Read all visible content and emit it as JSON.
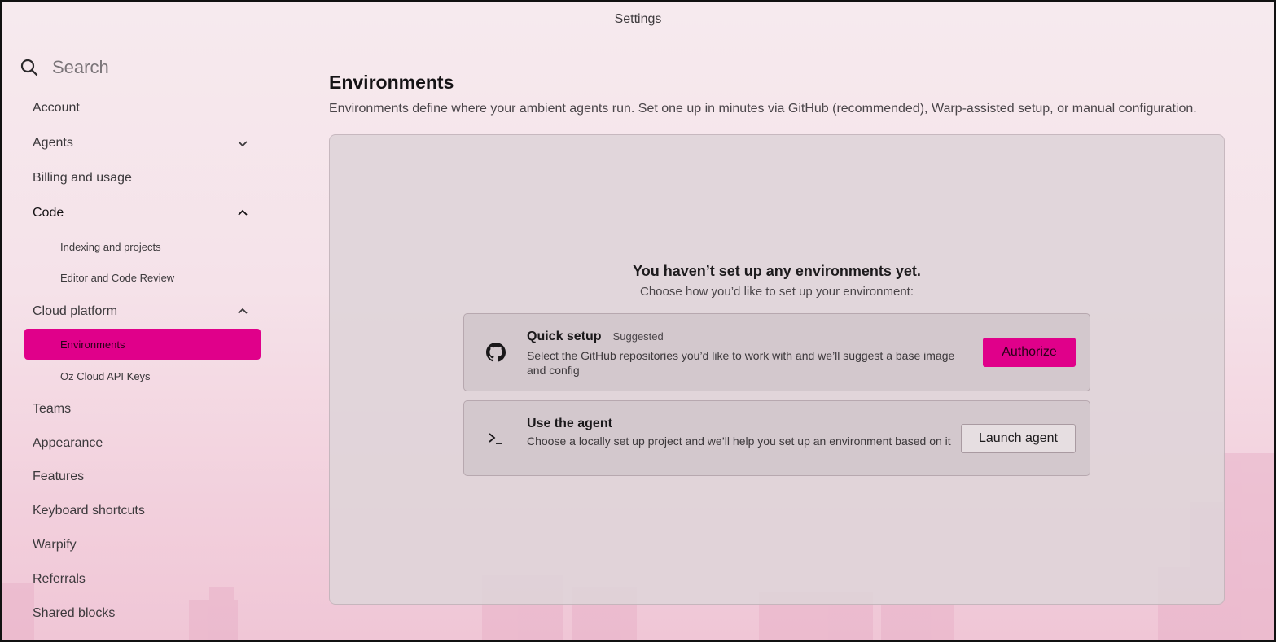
{
  "window": {
    "title": "Settings"
  },
  "search": {
    "placeholder": "Search"
  },
  "sidebar": {
    "items": [
      {
        "label": "Account"
      },
      {
        "label": "Agents"
      },
      {
        "label": "Billing and usage"
      },
      {
        "label": "Code"
      },
      {
        "label": "Cloud platform"
      },
      {
        "label": "Teams"
      },
      {
        "label": "Appearance"
      },
      {
        "label": "Features"
      },
      {
        "label": "Keyboard shortcuts"
      },
      {
        "label": "Warpify"
      },
      {
        "label": "Referrals"
      },
      {
        "label": "Shared blocks"
      }
    ],
    "code_sub": [
      {
        "label": "Indexing and projects"
      },
      {
        "label": "Editor and Code Review"
      }
    ],
    "cloud_sub": [
      {
        "label": "Environments",
        "selected": true
      },
      {
        "label": "Oz Cloud API Keys"
      }
    ]
  },
  "main": {
    "title": "Environments",
    "description": "Environments define where your ambient agents run. Set one up in minutes via GitHub (recommended), Warp-assisted setup, or manual configuration.",
    "empty_title": "You haven’t set up any environments yet.",
    "empty_subtitle": "Choose how you’d like to set up your environment:",
    "options": [
      {
        "name": "Quick setup",
        "tag": "Suggested",
        "description": "Select the GitHub repositories you’d like to work with and we’ll suggest a base image and config",
        "button": "Authorize",
        "icon": "github-icon"
      },
      {
        "name": "Use the agent",
        "description": "Choose a locally set up project and we’ll help you set up an environment based on it",
        "button": "Launch agent",
        "icon": "terminal-prompt-icon"
      }
    ]
  },
  "colors": {
    "accent": "#e0008a"
  }
}
